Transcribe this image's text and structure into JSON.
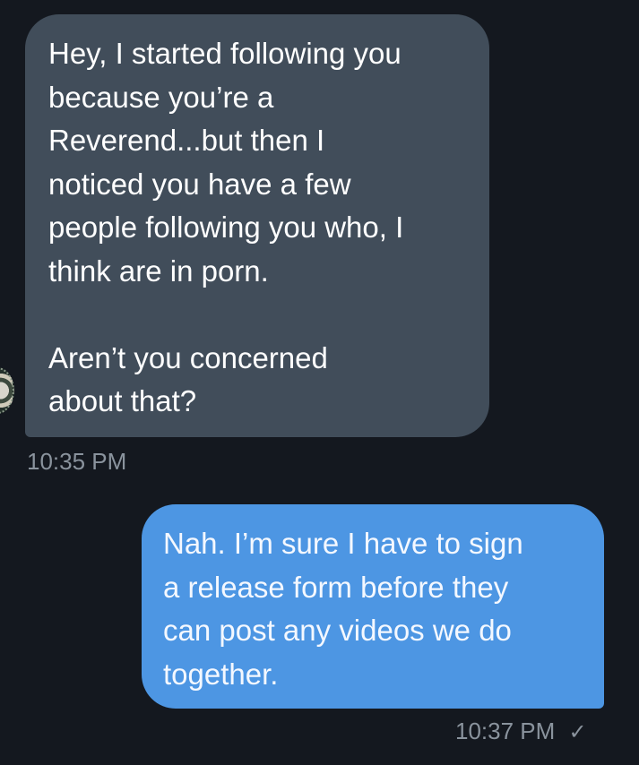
{
  "messages": [
    {
      "direction": "incoming",
      "lines": [
        "Hey, I started following you",
        "because you’re a",
        "Reverend...but then I",
        "noticed you have a few",
        "people following you who, I",
        "think are in porn."
      ],
      "lines2": [
        "Aren’t you concerned",
        "about that?"
      ],
      "time": "10:35 PM"
    },
    {
      "direction": "outgoing",
      "lines": [
        "Nah. I’m sure I have to sign",
        "a release form before they",
        "can post any videos we do",
        "together."
      ],
      "time": "10:37 PM",
      "status_icon": "✓"
    }
  ],
  "colors": {
    "background": "#14181f",
    "incoming_bubble": "#414d5a",
    "outgoing_bubble": "#4d96e3",
    "timestamp": "#8a939d"
  },
  "icons": {
    "avatar": "avatar-image",
    "read_status": "checkmark-icon"
  }
}
